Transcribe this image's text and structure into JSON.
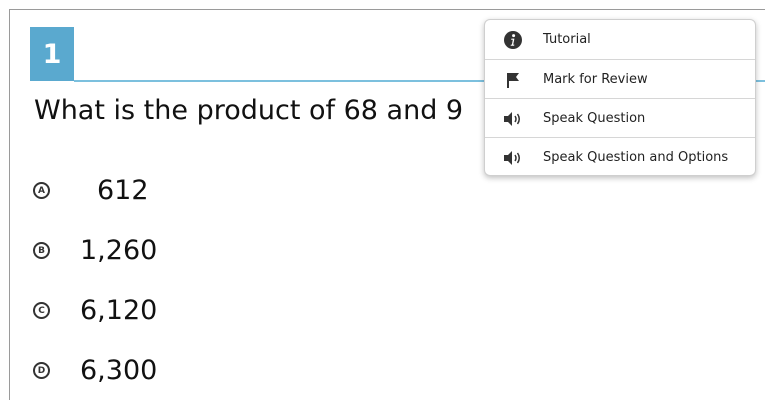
{
  "question": {
    "number": "1",
    "text": "What is the product of 68 and 9"
  },
  "options": [
    {
      "letter": "A",
      "value": "612"
    },
    {
      "letter": "B",
      "value": "1,260"
    },
    {
      "letter": "C",
      "value": "6,120"
    },
    {
      "letter": "D",
      "value": "6,300"
    }
  ],
  "menu": {
    "items": [
      {
        "label": "Tutorial",
        "icon": "info-icon"
      },
      {
        "label": "Mark for Review",
        "icon": "flag-icon"
      },
      {
        "label": "Speak Question",
        "icon": "speaker-icon"
      },
      {
        "label": "Speak Question and Options",
        "icon": "speaker-icon"
      }
    ]
  },
  "colors": {
    "accent": "#5aa9cf",
    "accent_line": "#7cc0de"
  }
}
